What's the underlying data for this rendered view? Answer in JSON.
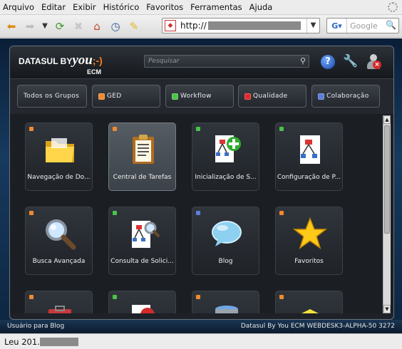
{
  "browser": {
    "menu": [
      "Arquivo",
      "Editar",
      "Exibir",
      "Histórico",
      "Favoritos",
      "Ferramentas",
      "Ajuda"
    ],
    "url_prefix": "http://",
    "search_engine": "G",
    "search_placeholder": "Google",
    "status_text": "Leu 201."
  },
  "app": {
    "logo_main": "DATASUL BY",
    "logo_you": "you",
    "logo_smile": ";-)",
    "logo_sub": "ECM",
    "search_placeholder": "Pesquisar",
    "help_label": "?",
    "tabs": [
      {
        "label": "Todos os Grupos",
        "color": ""
      },
      {
        "label": "GED",
        "color": "#f08a2e"
      },
      {
        "label": "Workflow",
        "color": "#4cc24a"
      },
      {
        "label": "Qualidade",
        "color": "#e02a2a"
      },
      {
        "label": "Colaboração",
        "color": "#5a7fd8"
      }
    ],
    "tiles": [
      {
        "label": "Navegação de Do...",
        "dot": "#f08a2e",
        "icon": "folder-icon"
      },
      {
        "label": "Central de Tarefas",
        "dot": "#f08a2e",
        "icon": "clipboard-icon"
      },
      {
        "label": "Inicialização de S...",
        "dot": "#4cc24a",
        "icon": "workflow-add-icon"
      },
      {
        "label": "Configuração de P...",
        "dot": "#4cc24a",
        "icon": "workflow-config-icon"
      },
      {
        "label": "Busca Avançada",
        "dot": "#f08a2e",
        "icon": "magnifier-icon"
      },
      {
        "label": "Consulta de Solici...",
        "dot": "#4cc24a",
        "icon": "workflow-search-icon"
      },
      {
        "label": "Blog",
        "dot": "#5a7fd8",
        "icon": "speech-bubble-icon"
      },
      {
        "label": "Favoritos",
        "dot": "#f08a2e",
        "icon": "star-icon"
      },
      {
        "label": "",
        "dot": "#f08a2e",
        "icon": "toolbox-icon"
      },
      {
        "label": "",
        "dot": "#4cc24a",
        "icon": "stop-sign-icon"
      },
      {
        "label": "",
        "dot": "#f08a2e",
        "icon": "database-icon"
      },
      {
        "label": "",
        "dot": "#f08a2e",
        "icon": "box-icon"
      }
    ],
    "footer_left": "Usuário para Blog",
    "footer_right": "Datasul By You ECM    WEBDESK3-ALPHA-50    3272"
  }
}
